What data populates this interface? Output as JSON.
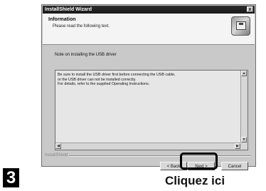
{
  "window": {
    "title": "InstallShield Wizard",
    "close_label": "x"
  },
  "header": {
    "title": "Information",
    "subtitle": "Please read the following text."
  },
  "content": {
    "note": "Note on installing the USB driver",
    "text_lines": [
      "Be sure to install the USB driver first before connecting the USB cable,",
      "or the USB driver can not be installed correctly.",
      "For details, refer to the supplied Operating Instructions."
    ]
  },
  "footer": {
    "installshield_label": "InstallShield",
    "back_label": "< Back",
    "next_label": "Next >",
    "cancel_label": "Cancel"
  },
  "annotation": {
    "step_number": "3",
    "caption": "Cliquez ici"
  },
  "icons": [
    "close-icon",
    "setup-disk-icon",
    "scroll-up-icon",
    "scroll-down-icon",
    "scroll-left-icon",
    "scroll-right-icon"
  ]
}
